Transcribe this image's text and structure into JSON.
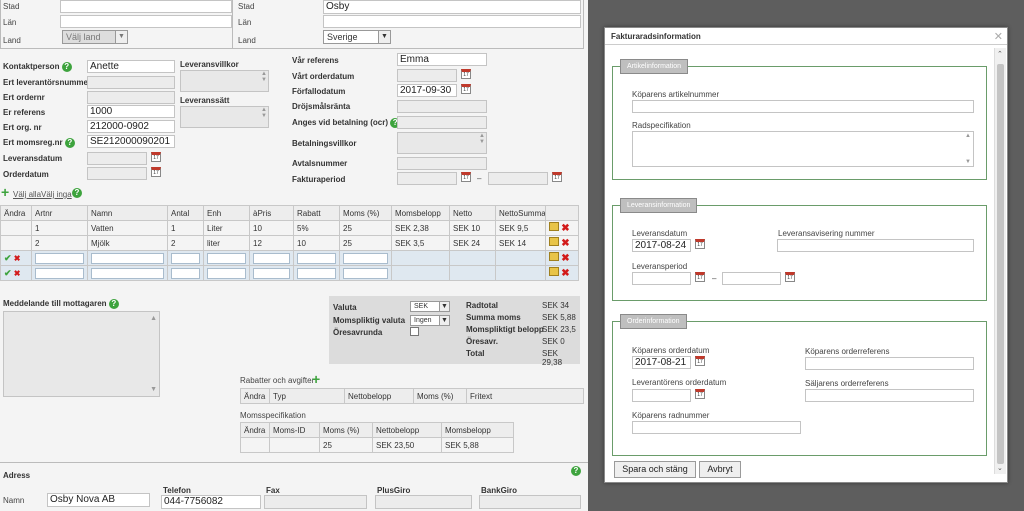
{
  "top": {
    "stad_label": "Stad",
    "lan_label": "Län",
    "land_label": "Land",
    "land_select": "Välj land",
    "stad2_label": "Stad",
    "stad2_value": "Osby",
    "lan2_label": "Län",
    "land2_label": "Land",
    "land2_select": "Sverige"
  },
  "left": {
    "kontaktperson_label": "Kontaktperson",
    "kontaktperson_value": "Anette",
    "levnr_label": "Ert leverantörsnummer",
    "ordernr_label": "Ert ordernr",
    "referens_label": "Er referens",
    "referens_value": "1000",
    "orgnr_label": "Ert org. nr",
    "orgnr_value": "212000-0902",
    "moms_label": "Ert momsreg.nr",
    "moms_value": "SE212000090201",
    "levdatum_label": "Leveransdatum",
    "orderdatum_label": "Orderdatum"
  },
  "mid": {
    "levvillkor_label": "Leveransvillkor",
    "levsatt_label": "Leveranssätt"
  },
  "right": {
    "varref_label": "Vår referens",
    "varref_value": "Emma",
    "varorderdatum_label": "Vårt orderdatum",
    "forfallo_label": "Förfallodatum",
    "forfallo_value": "2017-09-30",
    "drojsmal_label": "Dröjsmålsränta",
    "ocr_label": "Anges vid betalning (ocr)",
    "betvillkor_label": "Betalningsvillkor",
    "avtal_label": "Avtalsnummer",
    "period_label": "Fakturaperiod",
    "dash": "–"
  },
  "rows": {
    "valj_alla": "Välj alla",
    "valj_inga": "Välj inga"
  },
  "table": {
    "headers": [
      "Ändra",
      "Artnr",
      "Namn",
      "Antal",
      "Enh",
      "àPris",
      "Rabatt",
      "Moms (%)",
      "Momsbelopp",
      "Netto",
      "NettoSumma"
    ],
    "rows": [
      [
        "",
        "1",
        "Vatten",
        "1",
        "Liter",
        "10",
        "5%",
        "25",
        "SEK 2,38",
        "SEK 10",
        "SEK 9,5"
      ],
      [
        "",
        "2",
        "Mjölk",
        "2",
        "liter",
        "12",
        "10",
        "25",
        "SEK 3,5",
        "SEK 24",
        "SEK 14"
      ]
    ]
  },
  "meddelande": {
    "label": "Meddelande till mottagaren"
  },
  "valuta": {
    "valuta_label": "Valuta",
    "valuta_value": "SEK",
    "momsvaluta_label": "Momspliktig valuta",
    "momsvaluta_value": "Ingen",
    "ores_label": "Öresavrunda"
  },
  "totals": [
    {
      "label": "Radtotal",
      "value": "SEK 34"
    },
    {
      "label": "Summa moms",
      "value": "SEK 5,88"
    },
    {
      "label": "Momspliktigt belopp",
      "value": "SEK 23,5"
    },
    {
      "label": "Öresavr.",
      "value": "SEK 0"
    },
    {
      "label": "Total",
      "value": "SEK 29,38"
    }
  ],
  "rabatter": {
    "title": "Rabatter och avgifter",
    "headers": [
      "Ändra",
      "Typ",
      "Nettobelopp",
      "Moms (%)",
      "Fritext"
    ]
  },
  "momsspec": {
    "title": "Momsspecifikation",
    "headers": [
      "Ändra",
      "Moms-ID",
      "Moms (%)",
      "Nettobelopp",
      "Momsbelopp"
    ],
    "row": [
      "",
      "",
      "25",
      "SEK 23,50",
      "SEK 5,88"
    ]
  },
  "bottom": {
    "adress_label": "Adress",
    "namn_label": "Namn",
    "namn_value": "Osby Nova AB",
    "telefon_label": "Telefon",
    "telefon_value": "044-7756082",
    "fax_label": "Fax",
    "plusgiro_label": "PlusGiro",
    "bankgiro_label": "BankGiro"
  },
  "dialog": {
    "title": "Fakturaradsinformation",
    "close": "✕",
    "artikel_legend": "Artikelinformation",
    "artnr_label": "Köparens artikelnummer",
    "radspec_label": "Radspecifikation",
    "lev_legend": "Leveransinformation",
    "levdatum_label": "Leveransdatum",
    "levdatum_value": "2017-08-24",
    "levavis_label": "Leveransavisering nummer",
    "levperiod_label": "Leveransperiod",
    "dash": "–",
    "order_legend": "Orderinformation",
    "kop_orderdatum_label": "Köparens orderdatum",
    "kop_orderdatum_value": "2017-08-21",
    "kop_orderref_label": "Köparens orderreferens",
    "lev_orderdatum_label": "Leverantörens orderdatum",
    "salj_orderref_label": "Säljarens orderreferens",
    "radnr_label": "Köparens radnummer",
    "save_button": "Spara och stäng",
    "cancel_button": "Avbryt"
  },
  "icons": {
    "help": "?",
    "calendar": "17",
    "plus": "+",
    "check": "✔",
    "cross": "✖"
  }
}
